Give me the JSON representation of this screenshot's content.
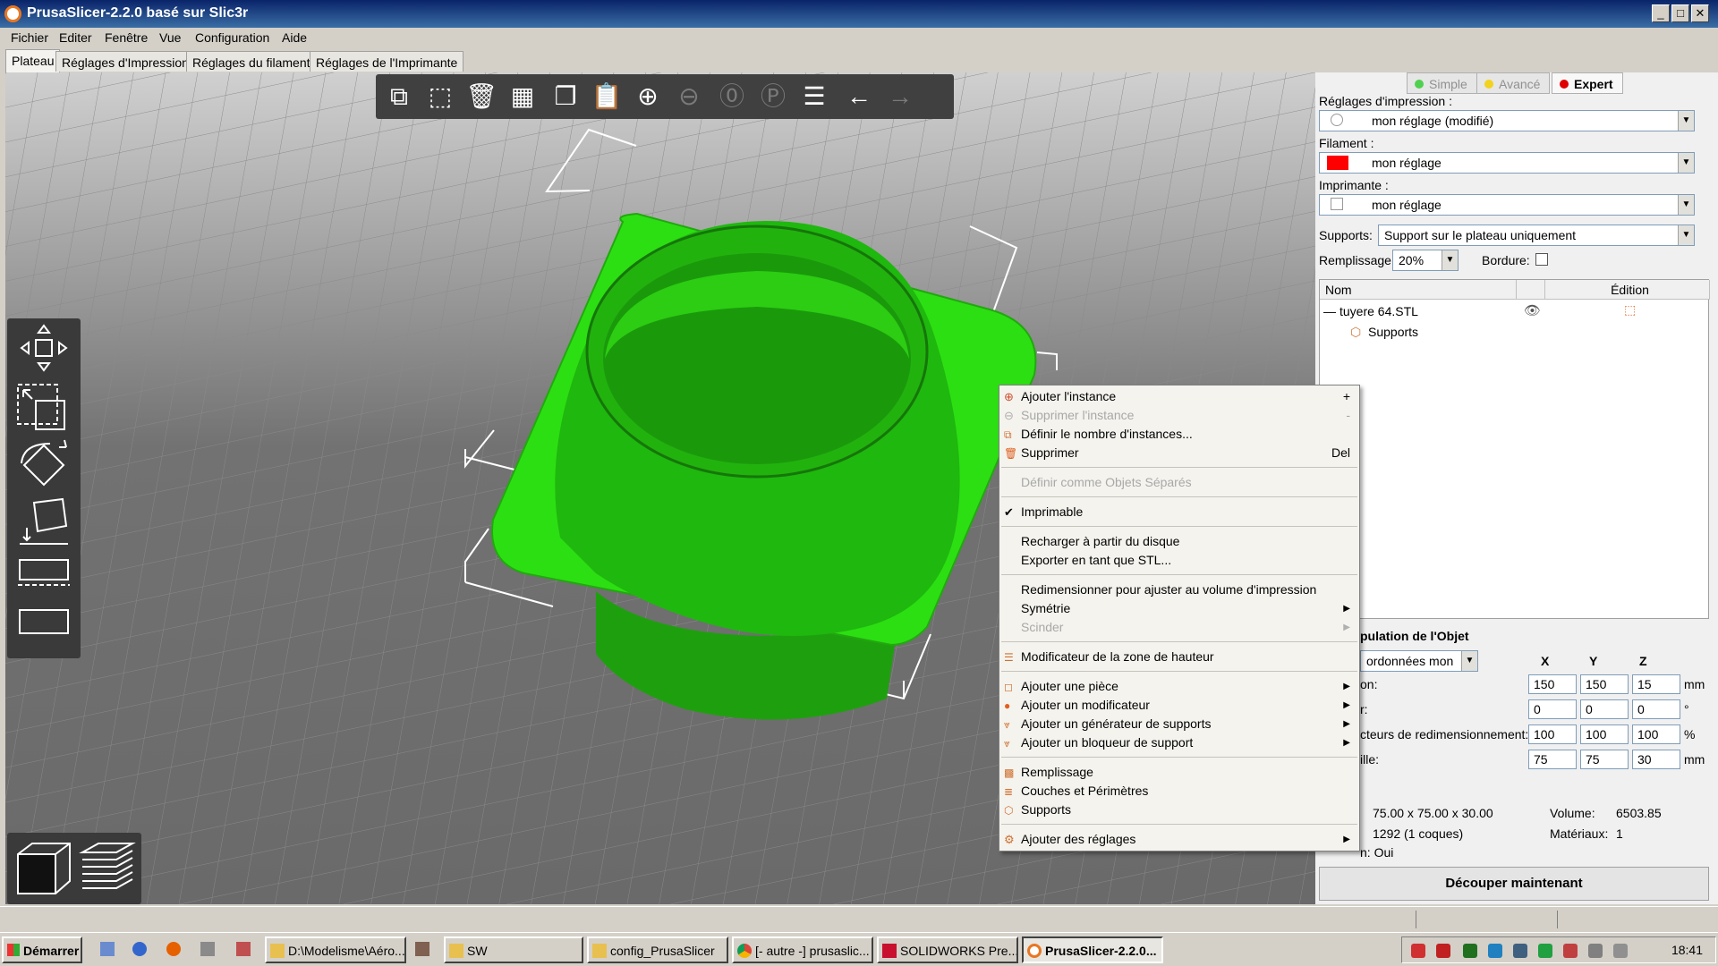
{
  "window": {
    "title": "PrusaSlicer-2.2.0 basé sur Slic3r"
  },
  "menubar": [
    "Fichier",
    "Editer",
    "Fenêtre",
    "Vue",
    "Configuration",
    "Aide"
  ],
  "tabs": [
    "Plateau",
    "Réglages d'Impression",
    "Réglages du filament",
    "Réglages de l'Imprimante"
  ],
  "mode": {
    "simple": "Simple",
    "advanced": "Avancé",
    "expert": "Expert"
  },
  "colors": {
    "model": "#2cdf12",
    "model_dark": "#1ea00e",
    "filament": "#ff0000",
    "expert_dot": "#e00000",
    "simple_dot": "#4fd14f",
    "advanced_dot": "#f2d21c",
    "titlebar": "#0a246a"
  },
  "presets": {
    "print_label": "Réglages d'impression :",
    "print_value": "mon réglage (modifié)",
    "filament_label": "Filament :",
    "filament_value": "mon réglage",
    "printer_label": "Imprimante :",
    "printer_value": "mon réglage",
    "supports_label": "Supports:",
    "supports_value": "Support sur le plateau uniquement",
    "infill_label": "Remplissage:",
    "infill_value": "20%",
    "brim_label": "Bordure:"
  },
  "object_list": {
    "col_name": "Nom",
    "col_edit": "Édition",
    "object_name": "tuyere 64.STL",
    "child": "Supports"
  },
  "manipulation": {
    "title": "pulation de l'Objet",
    "coord_combo": "ordonnées mon",
    "axes": [
      "X",
      "Y",
      "Z"
    ],
    "rows": [
      {
        "label": "on:",
        "values": [
          "150",
          "150",
          "15"
        ],
        "unit": "mm"
      },
      {
        "label": "r:",
        "values": [
          "0",
          "0",
          "0"
        ],
        "unit": "°"
      },
      {
        "label": "cteurs de redimensionnement:",
        "values": [
          "100",
          "100",
          "100"
        ],
        "unit": "%"
      },
      {
        "label": "ille:",
        "values": [
          "75",
          "75",
          "30"
        ],
        "unit": "mm"
      }
    ]
  },
  "info": {
    "size_value": "75.00 x 75.00 x 30.00",
    "volume_label": "Volume:",
    "volume_value": "6503.85",
    "facets_value": "1292 (1 coques)",
    "materials_label": "Matériaux:",
    "materials_value": "1",
    "manifold_text": "n: Oui"
  },
  "slice_button": "Découper maintenant",
  "context_menu": {
    "items": [
      {
        "label": "Ajouter l'instance",
        "shortcut": "+",
        "icon": "plus-circle-icon",
        "disabled": false
      },
      {
        "label": "Supprimer l'instance",
        "shortcut": "-",
        "icon": "minus-circle-icon",
        "disabled": true
      },
      {
        "label": "Définir le nombre d'instances...",
        "shortcut": "",
        "icon": "instances-icon",
        "disabled": false
      },
      {
        "label": "Supprimer",
        "shortcut": "Del",
        "icon": "trash-icon",
        "disabled": false
      },
      {
        "label": "Définir comme Objets Séparés",
        "shortcut": "",
        "icon": "",
        "disabled": true
      },
      {
        "label": "Imprimable",
        "shortcut": "",
        "icon": "checkmark-icon",
        "disabled": false
      },
      {
        "label": "Recharger à partir du disque",
        "shortcut": "",
        "icon": "",
        "disabled": false
      },
      {
        "label": "Exporter en tant que STL...",
        "shortcut": "",
        "icon": "",
        "disabled": false
      },
      {
        "label": "Redimensionner pour ajuster au volume d'impression",
        "shortcut": "",
        "icon": "",
        "disabled": false
      },
      {
        "label": "Symétrie",
        "shortcut": "",
        "icon": "",
        "disabled": false,
        "submenu": true
      },
      {
        "label": "Scinder",
        "shortcut": "",
        "icon": "",
        "disabled": true,
        "submenu": true
      },
      {
        "label": "Modificateur de la zone de hauteur",
        "shortcut": "",
        "icon": "height-range-icon",
        "disabled": false
      },
      {
        "label": "Ajouter une pièce",
        "shortcut": "",
        "icon": "add-part-icon",
        "disabled": false,
        "submenu": true
      },
      {
        "label": "Ajouter un modificateur",
        "shortcut": "",
        "icon": "add-modifier-icon",
        "disabled": false,
        "submenu": true
      },
      {
        "label": "Ajouter un générateur de supports",
        "shortcut": "",
        "icon": "support-enforcer-icon",
        "disabled": false,
        "submenu": true
      },
      {
        "label": "Ajouter un bloqueur de support",
        "shortcut": "",
        "icon": "support-blocker-icon",
        "disabled": false,
        "submenu": true
      },
      {
        "label": "Remplissage",
        "shortcut": "",
        "icon": "infill-icon",
        "disabled": false
      },
      {
        "label": "Couches et Périmètres",
        "shortcut": "",
        "icon": "layers-icon",
        "disabled": false
      },
      {
        "label": "Supports",
        "shortcut": "",
        "icon": "supports-icon",
        "disabled": false
      },
      {
        "label": "Ajouter des réglages",
        "shortcut": "",
        "icon": "settings-cog-icon",
        "disabled": false,
        "submenu": true
      }
    ]
  },
  "taskbar": {
    "start": "Démarrer",
    "tasks": [
      "D:\\Modelisme\\Aéro...",
      "SW",
      "config_PrusaSlicer",
      "[- autre -] prusaslic...",
      "SOLIDWORKS Pre...",
      "PrusaSlicer-2.2.0..."
    ],
    "clock": "18:41"
  }
}
